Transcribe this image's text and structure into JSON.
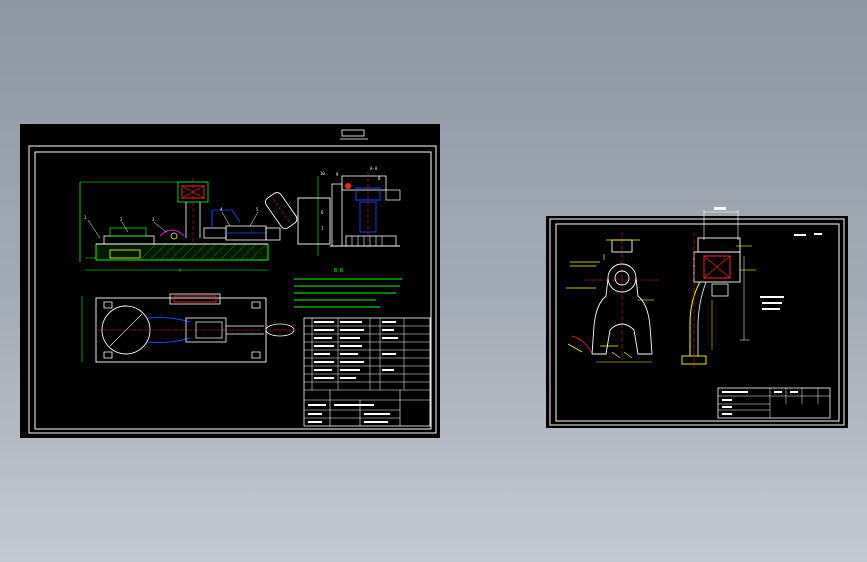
{
  "drawing": {
    "sheet_left": {
      "title_mark": "",
      "section_label": "A-A",
      "note_label": "B-B",
      "notes": [],
      "title_block": {
        "rows": []
      }
    },
    "sheet_right": {
      "tolerance_note": "",
      "title_block": {
        "rows": []
      }
    }
  },
  "colors": {
    "background_top": "#8d96a3",
    "background_bottom": "#c4c9d1",
    "sheet": "#000000",
    "line_white": "#ffffff",
    "line_green": "#00ff00",
    "line_red": "#ff2020",
    "line_blue": "#2040ff",
    "line_yellow": "#ffff00",
    "line_magenta": "#ff00ff",
    "line_cyan": "#00ffff"
  }
}
